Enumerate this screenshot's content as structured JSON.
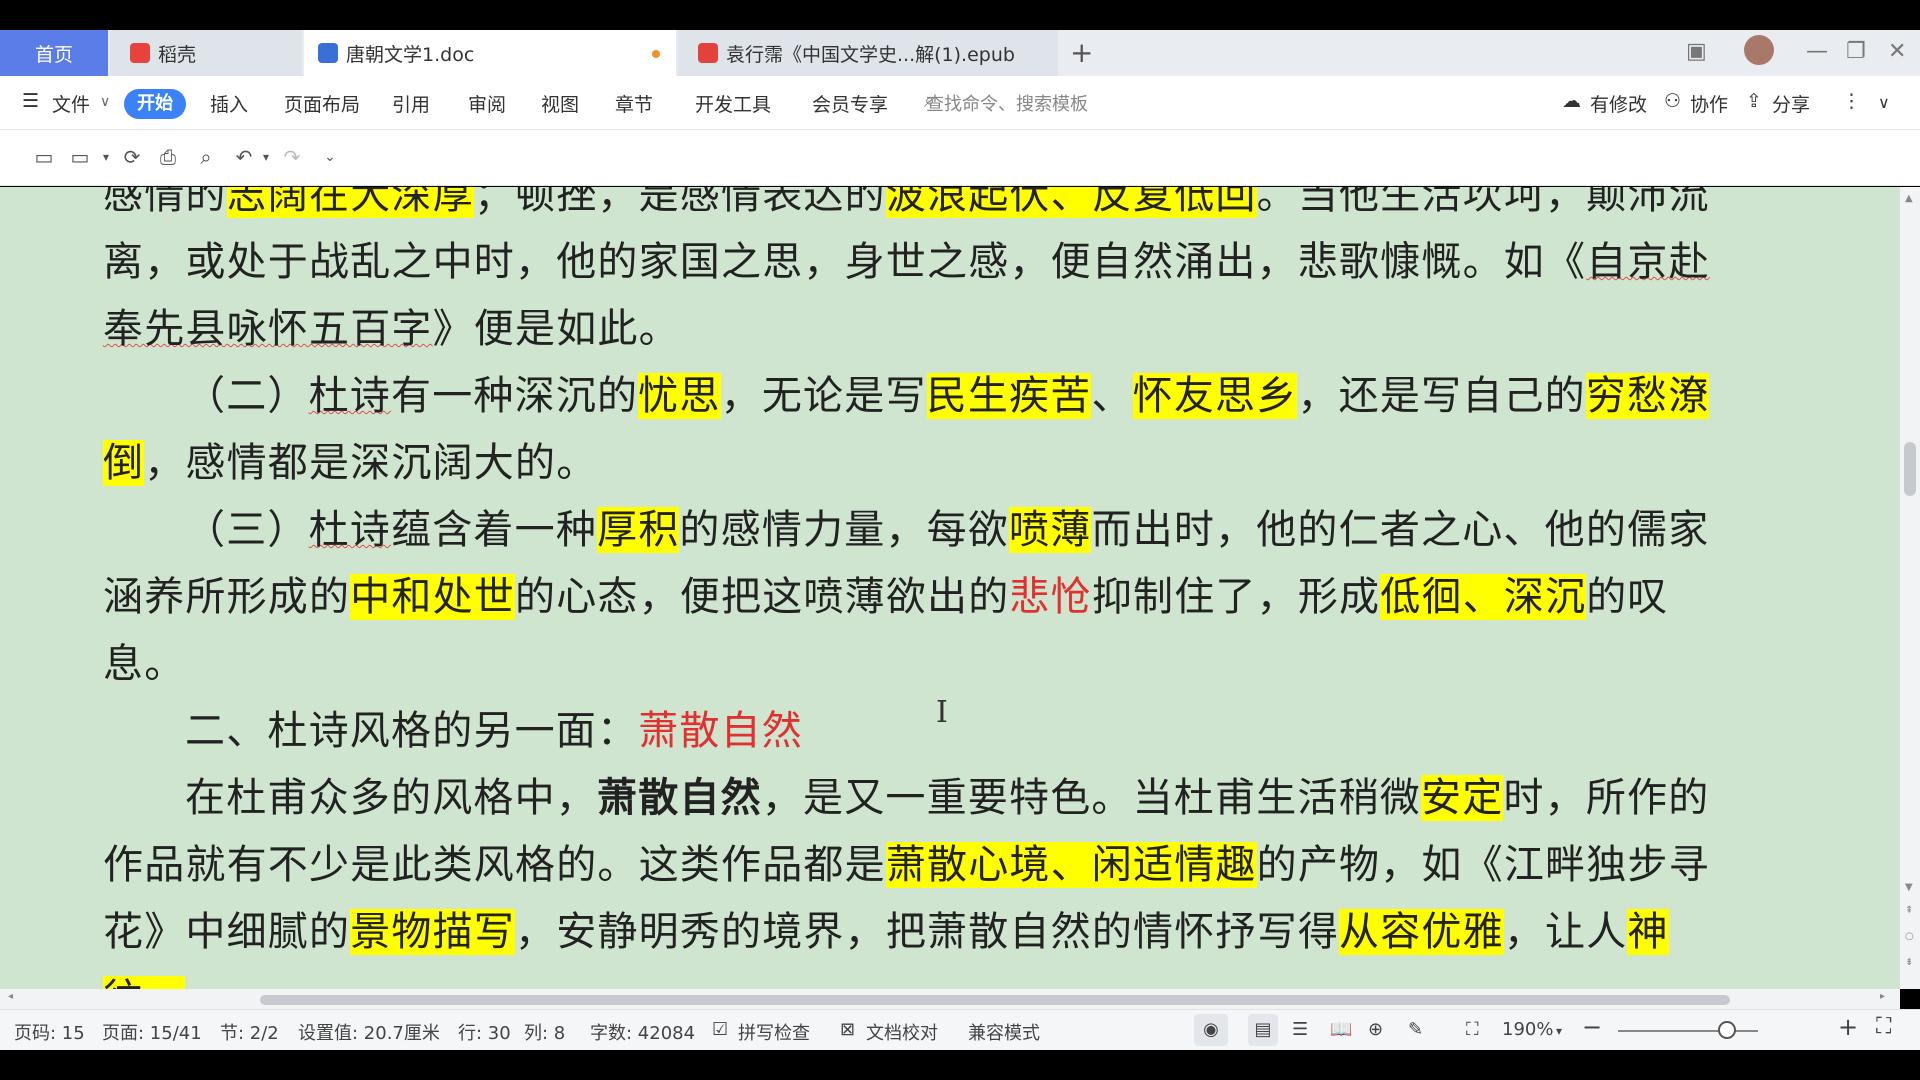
{
  "tabs": {
    "home": "首页",
    "docer": "稻壳",
    "doc": "唐朝文学1.doc",
    "epub": "袁行霈《中国文学史...解(1).epub"
  },
  "menu": {
    "file": "文件",
    "active": "开始",
    "insert": "插入",
    "layout": "页面布局",
    "ref": "引用",
    "review": "审阅",
    "view": "视图",
    "chapter": "章节",
    "dev": "开发工具",
    "vip": "会员专享",
    "search_placeholder": "查找命令、搜索模板",
    "modified": "有修改",
    "collab": "协作",
    "share": "分享"
  },
  "document": {
    "lines": [
      {
        "segments": [
          {
            "t": "感情的"
          },
          {
            "t": "志阔在大深厚",
            "hl": true
          },
          {
            "t": "；顿挫，是感情表达的"
          },
          {
            "t": "波浪起伏、反复低回",
            "hl": true
          },
          {
            "t": "。当他生活坎坷，颠沛流"
          }
        ]
      },
      {
        "segments": [
          {
            "t": "离，或处于战乱之中时，他的家国之思，身世之感，便自然涌出，悲歌慷慨。如《"
          },
          {
            "t": "自京赴",
            "ul": true
          }
        ]
      },
      {
        "segments": [
          {
            "t": "奉先县咏怀五百字",
            "ul": true
          },
          {
            "t": "》便是如此。"
          }
        ]
      },
      {
        "indent": 2,
        "segments": [
          {
            "t": "（二）"
          },
          {
            "t": "杜诗",
            "ul": true
          },
          {
            "t": "有一种深沉的"
          },
          {
            "t": "忧思",
            "hl": true
          },
          {
            "t": "，无论是写"
          },
          {
            "t": "民生疾苦",
            "hl": true
          },
          {
            "t": "、"
          },
          {
            "t": "怀友思乡",
            "hl": true
          },
          {
            "t": "，还是写自己的"
          },
          {
            "t": "穷愁潦",
            "hl": true
          }
        ]
      },
      {
        "segments": [
          {
            "t": "倒",
            "hl": true
          },
          {
            "t": "，感情都是深沉阔大的。"
          }
        ]
      },
      {
        "indent": 2,
        "segments": [
          {
            "t": "（三）"
          },
          {
            "t": "杜诗",
            "ul": true
          },
          {
            "t": "蕴含着一种"
          },
          {
            "t": "厚积",
            "hl": true
          },
          {
            "t": "的感情力量，每欲"
          },
          {
            "t": "喷薄",
            "hl": true
          },
          {
            "t": "而出时，他的仁者之心、他的儒家"
          }
        ]
      },
      {
        "segments": [
          {
            "t": "涵养所形成的"
          },
          {
            "t": "中和处世",
            "hl": true
          },
          {
            "t": "的心态，便把这喷薄欲出的"
          },
          {
            "t": "悲怆",
            "red": true
          },
          {
            "t": "抑制住了，形成"
          },
          {
            "t": "低徊、深沉",
            "hl": true
          },
          {
            "t": "的叹"
          }
        ]
      },
      {
        "segments": [
          {
            "t": "息。"
          }
        ]
      },
      {
        "indent": 2,
        "segments": [
          {
            "t": "二、杜诗风格的另一面："
          },
          {
            "t": "萧散自然",
            "red": true
          }
        ]
      },
      {
        "indent": 2,
        "segments": [
          {
            "t": "在杜甫众多的风格中，"
          },
          {
            "t": "萧散自然",
            "bold": true
          },
          {
            "t": "，是又一重要特色。当杜甫生活稍微"
          },
          {
            "t": "安定",
            "hl": true
          },
          {
            "t": "时，所作的"
          }
        ]
      },
      {
        "segments": [
          {
            "t": "作品就有不少是此类风格的。这类作品都是"
          },
          {
            "t": "萧散心境、闲适情趣",
            "hl": true
          },
          {
            "t": "的产物，如《江畔独步寻"
          }
        ]
      },
      {
        "segments": [
          {
            "t": "花》中细腻的"
          },
          {
            "t": "景物描写",
            "hl": true
          },
          {
            "t": "，安静明秀的境界，把萧散自然的情怀抒写得"
          },
          {
            "t": "从容优雅",
            "hl": true
          },
          {
            "t": "，让人"
          },
          {
            "t": "神",
            "hl": true
          }
        ]
      },
      {
        "segments": [
          {
            "t": "往。",
            "hl": true
          }
        ]
      }
    ]
  },
  "status": {
    "page_no": "页码: 15",
    "page": "页面: 15/41",
    "section": "节: 2/2",
    "setting": "设置值: 20.7厘米",
    "row": "行: 30",
    "col": "列: 8",
    "words": "字数: 42084",
    "spell": "拼写检查",
    "proof": "文档校对",
    "compat": "兼容模式",
    "zoom": "190%",
    "zoom_level": 0.78
  },
  "colors": {
    "doc_bg": "#cfe5cf",
    "highlight": "#ffff00",
    "accent": "#3b82f6",
    "red_text": "#e23030"
  }
}
